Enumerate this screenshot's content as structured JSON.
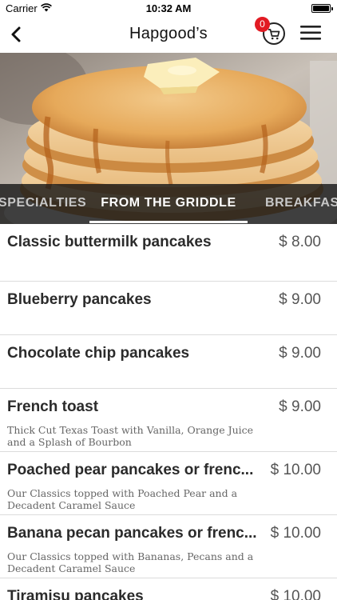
{
  "status_bar": {
    "carrier": "Carrier",
    "time": "10:32 AM"
  },
  "nav": {
    "title": "Hapgood’s",
    "cart_count": "0",
    "icons": {
      "back": "chevron-left-icon",
      "cart": "shopping-cart-icon",
      "menu": "hamburger-menu-icon"
    }
  },
  "hero": {
    "subject": "stack of pancakes with syrup and butter"
  },
  "tabs": [
    {
      "label": "SPECIALTIES",
      "active": false
    },
    {
      "label": "FROM THE GRIDDLE",
      "active": true
    },
    {
      "label": "BREAKFAST",
      "active": false
    }
  ],
  "items": [
    {
      "name": "Classic buttermilk pancakes",
      "price": "$ 8.00",
      "description": ""
    },
    {
      "name": "Blueberry pancakes",
      "price": "$ 9.00",
      "description": ""
    },
    {
      "name": "Chocolate chip pancakes",
      "price": "$ 9.00",
      "description": ""
    },
    {
      "name": "French toast",
      "price": "$ 9.00",
      "description": "Thick Cut Texas Toast with Vanilla, Orange Juice and a Splash of Bourbon"
    },
    {
      "name": "Poached pear pancakes or frenc...",
      "price": "$ 10.00",
      "description": "Our Classics topped with Poached Pear and a Decadent Caramel Sauce"
    },
    {
      "name": "Banana pecan pancakes or frenc...",
      "price": "$ 10.00",
      "description": "Our Classics topped with Bananas, Pecans and a Decadent Caramel Sauce"
    },
    {
      "name": "Tiramisu pancakes",
      "price": "$ 10.00",
      "description": ""
    }
  ],
  "colors": {
    "badge": "#e21b23",
    "tab_strip": "#181818",
    "divider": "#dcdcdc"
  }
}
